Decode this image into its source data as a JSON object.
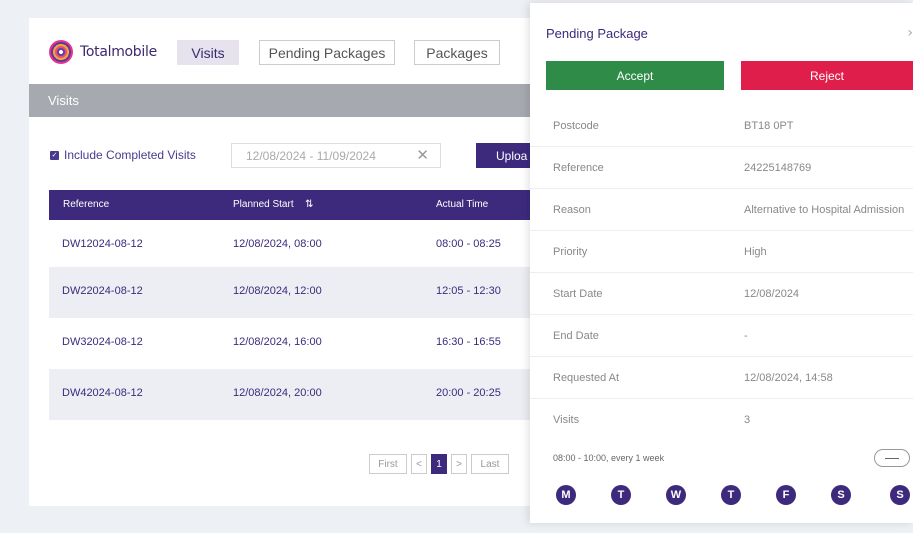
{
  "brand": {
    "name": "Totalmobile"
  },
  "nav": {
    "visits": "Visits",
    "pending": "Pending Packages",
    "packages": "Packages"
  },
  "section": {
    "title": "Visits"
  },
  "filters": {
    "include_completed": "Include Completed Visits",
    "date_range": "12/08/2024 - 11/09/2024",
    "clear_glyph": "✕",
    "upload_label": "Uploa"
  },
  "table": {
    "headers": {
      "reference": "Reference",
      "planned": "Planned Start",
      "sort_glyph": "⇅",
      "actual": "Actual Time"
    },
    "rows": [
      {
        "ref": "DW12024-08-12",
        "planned": "12/08/2024, 08:00",
        "actual": "08:00 - 08:25"
      },
      {
        "ref": "DW22024-08-12",
        "planned": "12/08/2024, 12:00",
        "actual": "12:05 - 12:30"
      },
      {
        "ref": "DW32024-08-12",
        "planned": "12/08/2024, 16:00",
        "actual": "16:30 - 16:55"
      },
      {
        "ref": "DW42024-08-12",
        "planned": "12/08/2024, 20:00",
        "actual": "20:00 - 20:25"
      }
    ]
  },
  "pager": {
    "first": "First",
    "prev": "<",
    "page": "1",
    "next": ">",
    "last": "Last"
  },
  "panel": {
    "title": "Pending Package",
    "close_glyph": "›",
    "accept": "Accept",
    "reject": "Reject",
    "fields": [
      {
        "k": "Postcode",
        "v": "BT18 0PT"
      },
      {
        "k": "Reference",
        "v": "24225148769"
      },
      {
        "k": "Reason",
        "v": "Alternative to Hospital Admission"
      },
      {
        "k": "Priority",
        "v": "High"
      },
      {
        "k": "Start Date",
        "v": "12/08/2024"
      },
      {
        "k": "End Date",
        "v": "-"
      },
      {
        "k": "Requested At",
        "v": "12/08/2024, 14:58"
      },
      {
        "k": "Visits",
        "v": "3"
      }
    ],
    "schedule": "08:00 - 10:00, every 1 week",
    "days": [
      "M",
      "T",
      "W",
      "T",
      "F",
      "S",
      "S"
    ]
  },
  "colors": {
    "primary": "#3d2a7d",
    "accept": "#2e8b48",
    "reject": "#e01e4b",
    "section_bar": "#a6a9b0"
  }
}
